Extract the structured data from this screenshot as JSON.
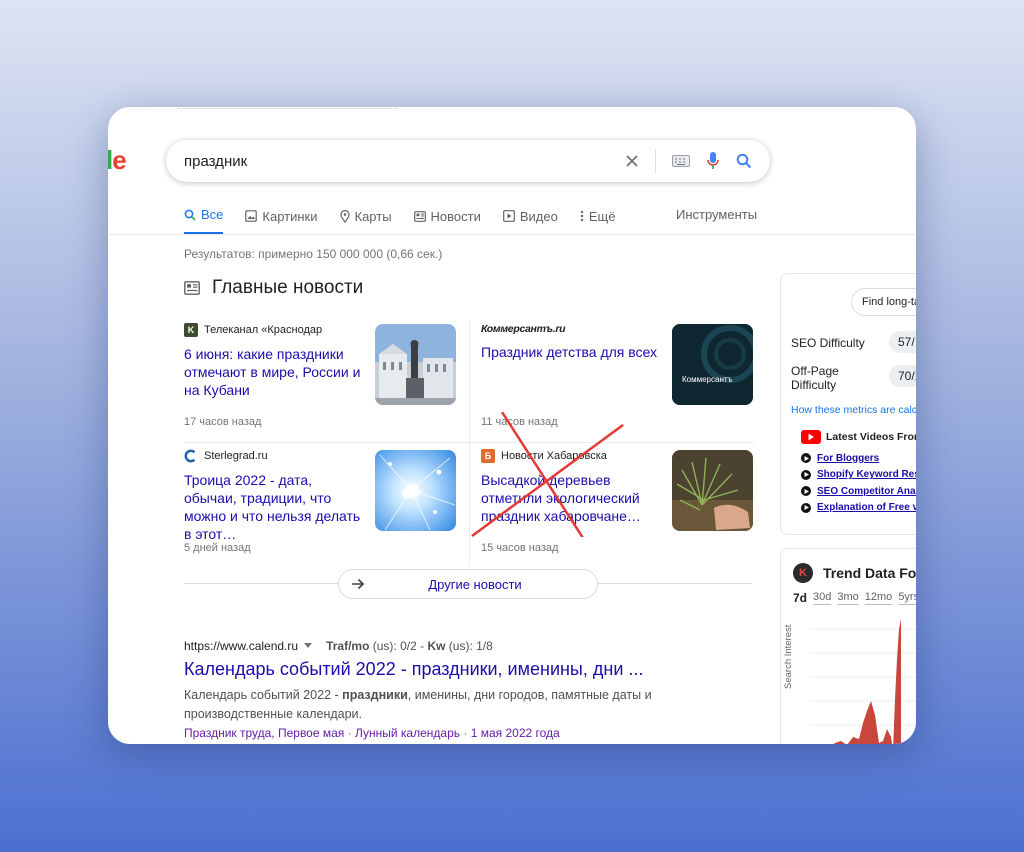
{
  "search": {
    "query": "праздник"
  },
  "tabs": [
    {
      "label": "Все",
      "active": true
    },
    {
      "label": "Картинки"
    },
    {
      "label": "Карты"
    },
    {
      "label": "Новости"
    },
    {
      "label": "Видео"
    },
    {
      "label": "Ещё"
    }
  ],
  "tools_label": "Инструменты",
  "results_count": "Результатов: примерно 150 000 000 (0,66 сек.)",
  "news": {
    "heading": "Главные новости",
    "items": [
      {
        "source": "Телеканал «Краснодар",
        "title": "6 июня: какие праздники отмечают в мире, России и на Кубани",
        "time": "17 часов назад"
      },
      {
        "source": "Коммерсантъ.ru",
        "title": "Праздник детства для всех",
        "time": "11 часов назад",
        "thumb_text": "Коммерсантъ"
      },
      {
        "source": "Sterlegrad.ru",
        "title": "Троица 2022 - дата, обычаи, традиции, что можно и что нельзя делать в этот…",
        "time": "5 дней назад"
      },
      {
        "source": "Новости Хабаровска",
        "title": "Высадкой деревьев отметили экологический праздник хабаровчане…",
        "time": "15 часов назад"
      }
    ],
    "more_label": "Другие новости"
  },
  "result": {
    "url": "https://www.calend.ru",
    "traf_label": "Traf/mo",
    "traf_us": "(us): 0/2",
    "kw_label": "Kw",
    "kw_us": "(us): 1/8",
    "title": "Календарь событий 2022 - праздники, именины, дни ...",
    "snippet_1": "Календарь событий 2022 - ",
    "snippet_bold": "праздники",
    "snippet_2": ", именины, дни городов, памятные даты и производственные календари.",
    "link_1": "Праздник труда, Первое мая",
    "link_2": "Лунный календарь",
    "link_3": "1 мая 2022 года"
  },
  "seo_panel": {
    "find_button": "Find long-ta",
    "seo_label": "SEO Difficulty",
    "seo_value": "57/",
    "offpage_label_1": "Off-Page",
    "offpage_label_2": "Difficulty",
    "offpage_value": "70/1",
    "how_link": "How these metrics are calc",
    "latest_videos": "Latest Videos From",
    "videos": [
      "For Bloggers",
      "Shopify Keyword Res",
      "SEO Competitor Anal",
      "Explanation of Free v"
    ]
  },
  "trend": {
    "title": "Trend Data Fo",
    "ranges": [
      "7d",
      "30d",
      "3mo",
      "12mo",
      "5yrs"
    ],
    "active_range": "7d",
    "y_label": "Search Interest"
  },
  "colors": {
    "link": "#1a0dab",
    "accent": "#1a73e8",
    "visited": "#681da8",
    "trend_fill": "#c9463d"
  }
}
